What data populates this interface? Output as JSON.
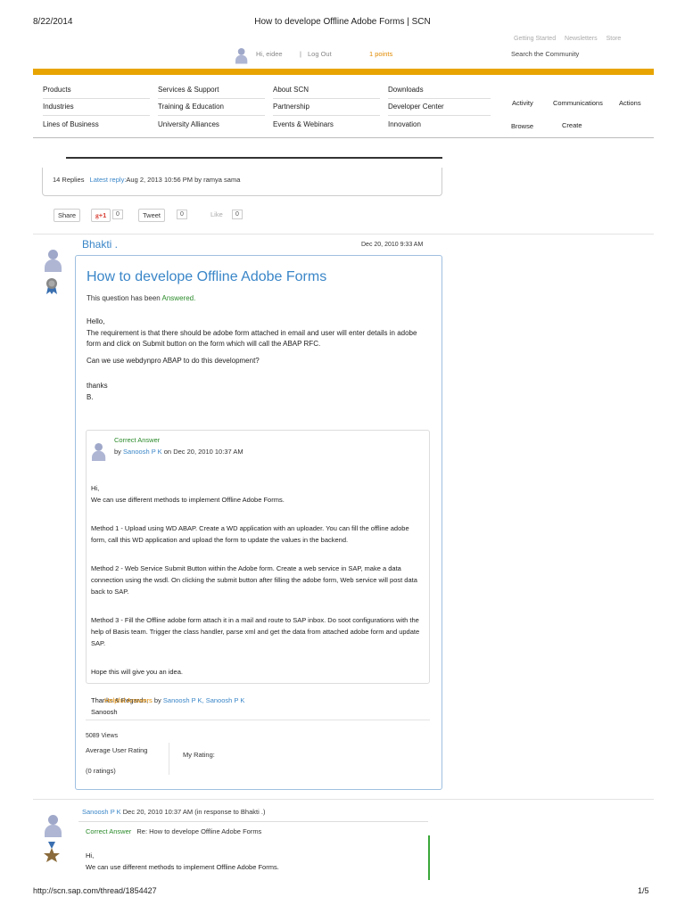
{
  "print_header": {
    "date": "8/22/2014",
    "title": "How to develope Offline Adobe Forms | SCN"
  },
  "print_footer": {
    "url": "http://scn.sap.com/thread/1854427",
    "page": "1/5"
  },
  "top_links": [
    "Getting Started",
    "Newsletters",
    "Store"
  ],
  "user_bar": {
    "greeting": "Hi, eidee",
    "separator": "|",
    "logout": "Log Out",
    "points": "1 points",
    "search": "Search the Community"
  },
  "colors": {
    "accent_bar": "#e8a400",
    "link_blue": "#3a86c8",
    "answer_green": "#2a8a2a",
    "helpful_orange": "#e08a00"
  },
  "nav": {
    "columns": [
      [
        "Products",
        "Industries",
        "Lines of Business"
      ],
      [
        "Services & Support",
        "Training & Education",
        "University Alliances"
      ],
      [
        "About SCN",
        "Partnership",
        "Events & Webinars"
      ],
      [
        "Downloads",
        "Developer Center",
        "Innovation"
      ]
    ],
    "right": {
      "activity": "Activity",
      "communications": "Communications",
      "actions": "Actions",
      "browse": "Browse",
      "create": "Create"
    }
  },
  "thread_info": {
    "replies": "14 Replies",
    "latest_label": "Latest reply:",
    "latest": "Aug 2, 2013 10:56 PM by ramya sama"
  },
  "social": {
    "share": "Share",
    "gplus": "+1",
    "gplus_count": "0",
    "tweet": "Tweet",
    "tweet_count": "0",
    "like": "Like",
    "like_count": "0"
  },
  "question": {
    "author": "Bhakti .",
    "date": "Dec 20, 2010 9:33 AM",
    "title": "How to develope Offline Adobe Forms",
    "status_prefix": "This question has been",
    "status": "Answered.",
    "body": [
      "Hello,",
      "The requirement is that there should be adobe form attached in email and user will enter details in adobe form and click on Submit button on the form which will call the ABAP RFC.",
      "Can we use webdynpro ABAP to do this development?",
      "thanks",
      "B."
    ],
    "views": "5089 Views",
    "avg_rating": "Average User Rating",
    "ratings": "(0 ratings)",
    "my_rating": "My Rating:",
    "helpful_label": "Helpful Answers",
    "helpful_by": "by",
    "helpful_names": "Sanoosh P K, Sanoosh P K"
  },
  "correct_answer": {
    "label": "Correct Answer",
    "by": "by",
    "author": "Sanoosh P K",
    "date": "on Dec 20, 2010 10:37 AM",
    "body": [
      "Hi,\nWe can use different methods to implement Offline Adobe Forms.",
      "Method 1 - Upload using WD ABAP. Create a WD application with an uploader. You can fill the offline adobe form, call this WD application and upload the form to update the values in the backend.",
      "Method 2 - Web Service Submit Button within the Adobe form. Create a web service in SAP, make a data connection using the wsdl. On clicking the submit button after filling the adobe form, Web service will post data back to SAP.",
      "Method 3 - Fill the Offline adobe form attach it in a mail and route to SAP inbox. Do soot configurations with the help of Basis team. Trigger the class handler, parse xml and get the data from attached adobe form and update SAP.",
      "Hope this will give you an idea.",
      "Thanks & Regards,\nSanoosh"
    ]
  },
  "reply": {
    "author": "Sanoosh P K",
    "date": "Dec 20, 2010 10:37 AM",
    "in_response": "(in response to Bhakti .)",
    "label": "Correct Answer",
    "subject": "Re: How to develope Offline Adobe Forms",
    "body": "Hi,\nWe can use different methods to implement Offline Adobe Forms."
  }
}
